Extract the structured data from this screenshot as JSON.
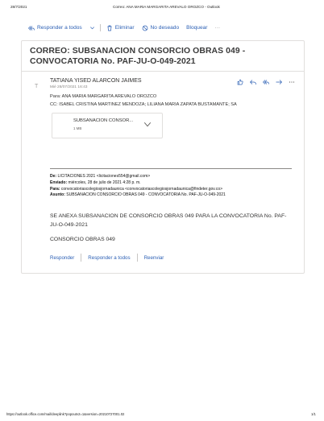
{
  "print_header": {
    "date": "28/7/2021",
    "title": "Correo: ANA MARIA MARGARITA AREVALO OROZCO - Outlook"
  },
  "toolbar": {
    "reply_all": "Responder a todos",
    "delete": "Eliminar",
    "junk": "No deseado",
    "block": "Bloquear",
    "more": "···"
  },
  "message": {
    "subject": "CORREO: SUBSANACION CONSORCIO OBRAS 049 - CONVOCATORIA No. PAF-JU-O-049-2021",
    "avatar_initial": "T",
    "sender": "TATIANA YISED ALARCON JAIMES",
    "date": "Mié 28/07/2021 16:43",
    "to": "Para:  ANA MARIA MARGARITA AREVALO OROZCO",
    "cc": "CC:  ISABEL CRISTINA MARTINEZ MENDOZA; LILIANA MARIA ZAPATA BUSTAMANTE; SA",
    "attachment": {
      "name": "SUBSANACION CONSOR...",
      "size": "1 MB"
    },
    "forwarded": {
      "from_label": "De:",
      "from": "LICITACIONES 2021 <licitaciones554@gmail.com>",
      "sent_label": "Enviado:",
      "sent": "miércoles, 28 de julio de 2021 4:28 p. m.",
      "to_label": "Para:",
      "to": "convocatoriascolegiosjornadaunica <convocatoriascolegiosjornadaunica@findeter.gov.co>",
      "subject_label": "Asunto:",
      "subject": "SUBSANACION CONSORCIO OBRAS 049 - CONVOCATORIA No. PAF-JU-O-049-2021"
    },
    "body_line1": "SE ANEXA SUBSANACION DE CONSORCIO OBRAS 049 PARA LA  CONVOCATORIA No. PAF-JU-O-049-2021",
    "body_line2": "CONSORCIO OBRAS 049",
    "reply": "Responder",
    "reply_all": "Responder a todos",
    "forward": "Reenviar"
  },
  "print_footer": {
    "url": "https://outlook.office.com/mail/deeplink?popoutv2=1&version=20210727001.02",
    "page": "1/1"
  },
  "colors": {
    "accent": "#2b5fb4",
    "text": "#323130"
  }
}
